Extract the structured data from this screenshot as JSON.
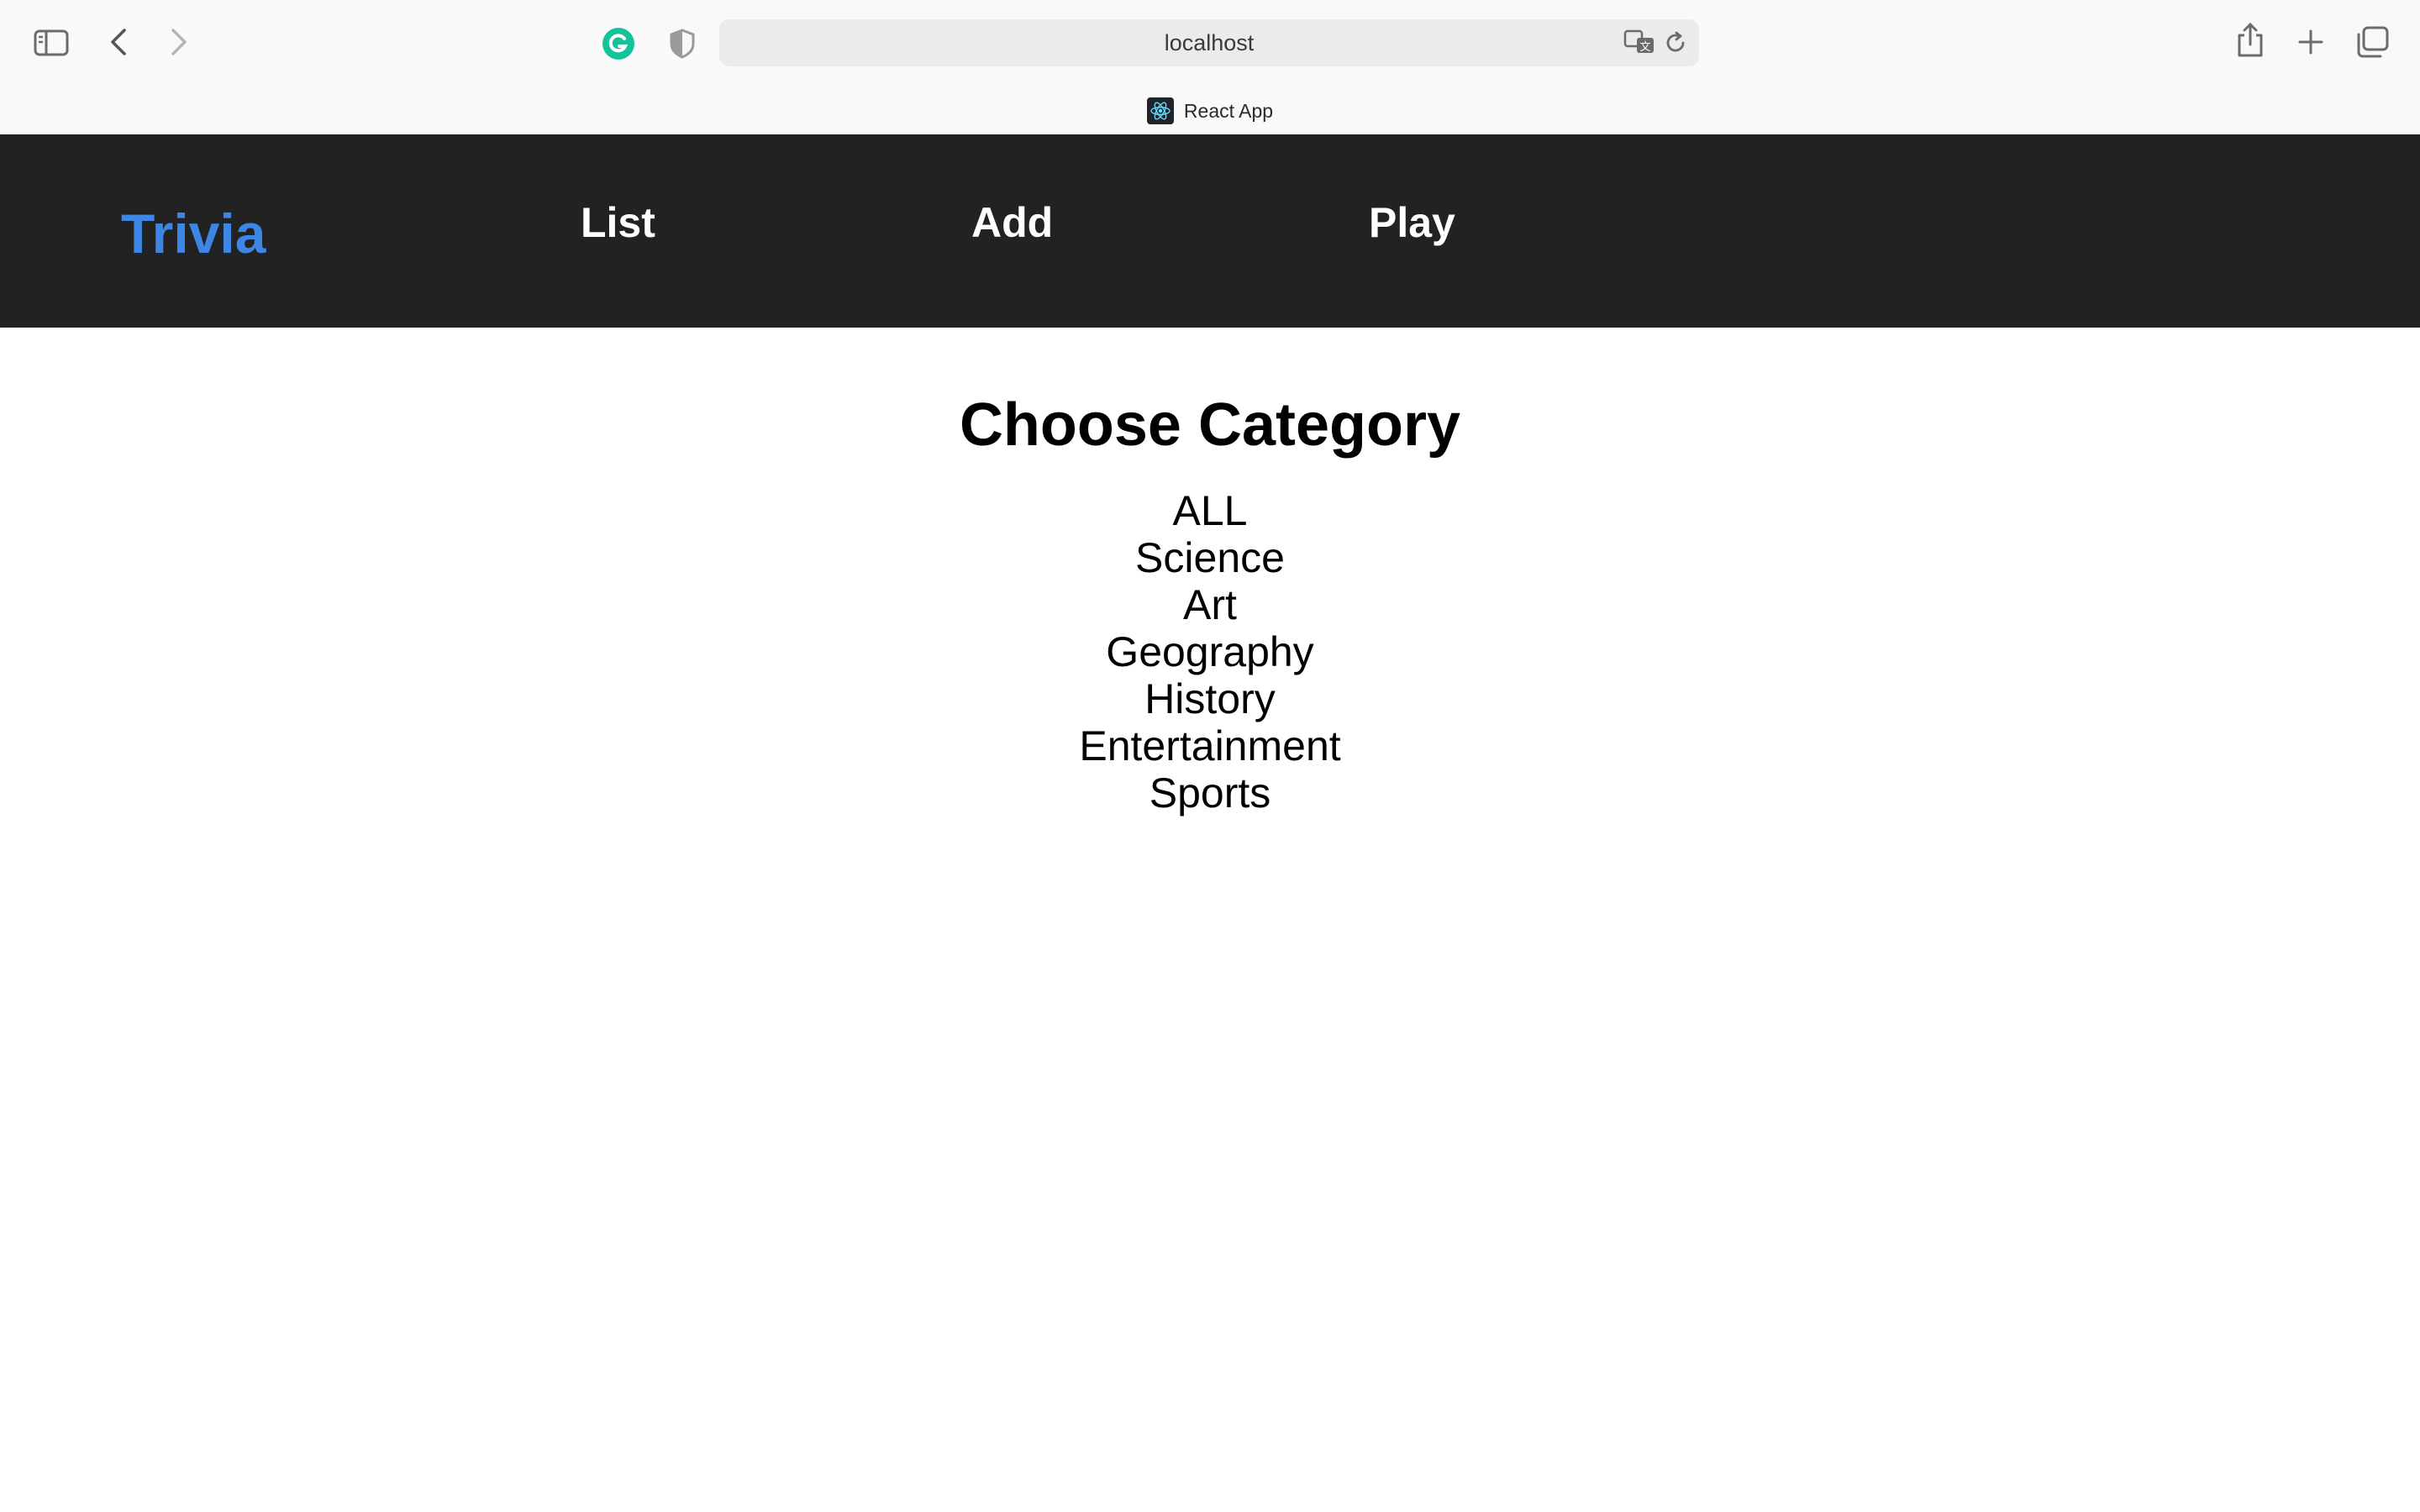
{
  "browser": {
    "address": "localhost",
    "tab_title": "React App",
    "icons": {
      "sidebar": "sidebar-icon",
      "back": "chevron-left-icon",
      "forward": "chevron-right-icon",
      "grammarly": "grammarly-icon",
      "privacy": "shield-icon",
      "translate": "translate-icon",
      "reload": "reload-icon",
      "share": "share-icon",
      "new_tab": "plus-icon",
      "tab_overview": "tabs-icon",
      "favicon": "react-icon"
    }
  },
  "nav": {
    "brand": "Trivia",
    "links": [
      "List",
      "Add",
      "Play"
    ],
    "brand_color": "#3d86e6",
    "background": "#222222"
  },
  "main": {
    "title": "Choose Category",
    "categories": [
      "ALL",
      "Science",
      "Art",
      "Geography",
      "History",
      "Entertainment",
      "Sports"
    ]
  }
}
